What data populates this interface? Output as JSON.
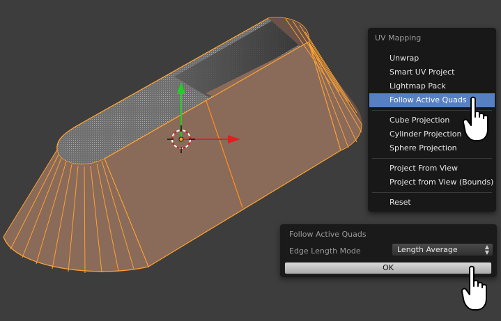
{
  "menu": {
    "title": "UV Mapping",
    "items": [
      {
        "label": "Unwrap"
      },
      {
        "label": "Smart UV Project"
      },
      {
        "label": "Lightmap Pack"
      },
      {
        "label": "Follow Active Quads",
        "active": true
      },
      {
        "label": "Cube Projection"
      },
      {
        "label": "Cylinder Projection"
      },
      {
        "label": "Sphere Projection"
      },
      {
        "label": "Project From View"
      },
      {
        "label": "Project from View (Bounds)"
      },
      {
        "label": "Reset"
      }
    ]
  },
  "redo_panel": {
    "title": "Follow Active Quads",
    "edge_length_label": "Edge Length Mode",
    "edge_length_value": "Length Average",
    "ok_label": "OK"
  },
  "colors": {
    "background": "#3d3d3d",
    "mesh_face": "#8a6a59",
    "selected_edge": "#ffa331",
    "menu_highlight": "#5680c2",
    "gizmo_x": "#e02020",
    "gizmo_y": "#20d020"
  },
  "icons": {
    "cursor": "hand-pointer-icon",
    "origin": "3d-cursor-icon"
  }
}
